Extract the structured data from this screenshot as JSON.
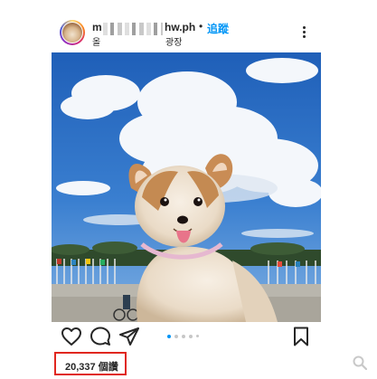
{
  "post": {
    "username_prefix": "m",
    "username_suffix": "hw.ph",
    "separator": "•",
    "follow_label": "追蹤",
    "location_prefix": "올",
    "location_suffix": "광장",
    "likes": "20,337 個讚",
    "carousel": {
      "count": 5,
      "active_index": 0
    }
  },
  "icons": {
    "more": "more-options-icon",
    "like": "heart-icon",
    "comment": "comment-icon",
    "share": "send-icon",
    "save": "bookmark-icon",
    "watermark": "search-icon"
  },
  "colors": {
    "link": "#0095f6",
    "highlight_border": "#e0271f",
    "text": "#262626"
  }
}
